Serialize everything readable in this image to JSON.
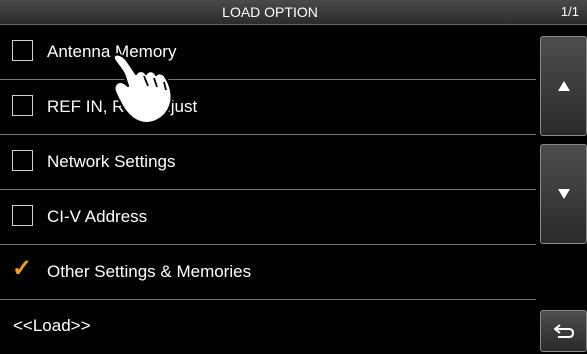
{
  "header": {
    "title": "LOAD OPTION",
    "page": "1/1"
  },
  "options": [
    {
      "label": "Antenna Memory",
      "checked": false
    },
    {
      "label": "REF IN, REF Adjust",
      "checked": false
    },
    {
      "label": "Network Settings",
      "checked": false
    },
    {
      "label": "CI-V Address",
      "checked": false
    },
    {
      "label": "Other Settings & Memories",
      "checked": true
    }
  ],
  "load_label": "<<Load>>",
  "colors": {
    "check": "#f4a200",
    "background": "#000000",
    "text": "#ffffff"
  },
  "icons": {
    "up": "triangle-up-icon",
    "down": "triangle-down-icon",
    "back": "return-arrow-icon",
    "pointer": "hand-pointer-icon"
  }
}
